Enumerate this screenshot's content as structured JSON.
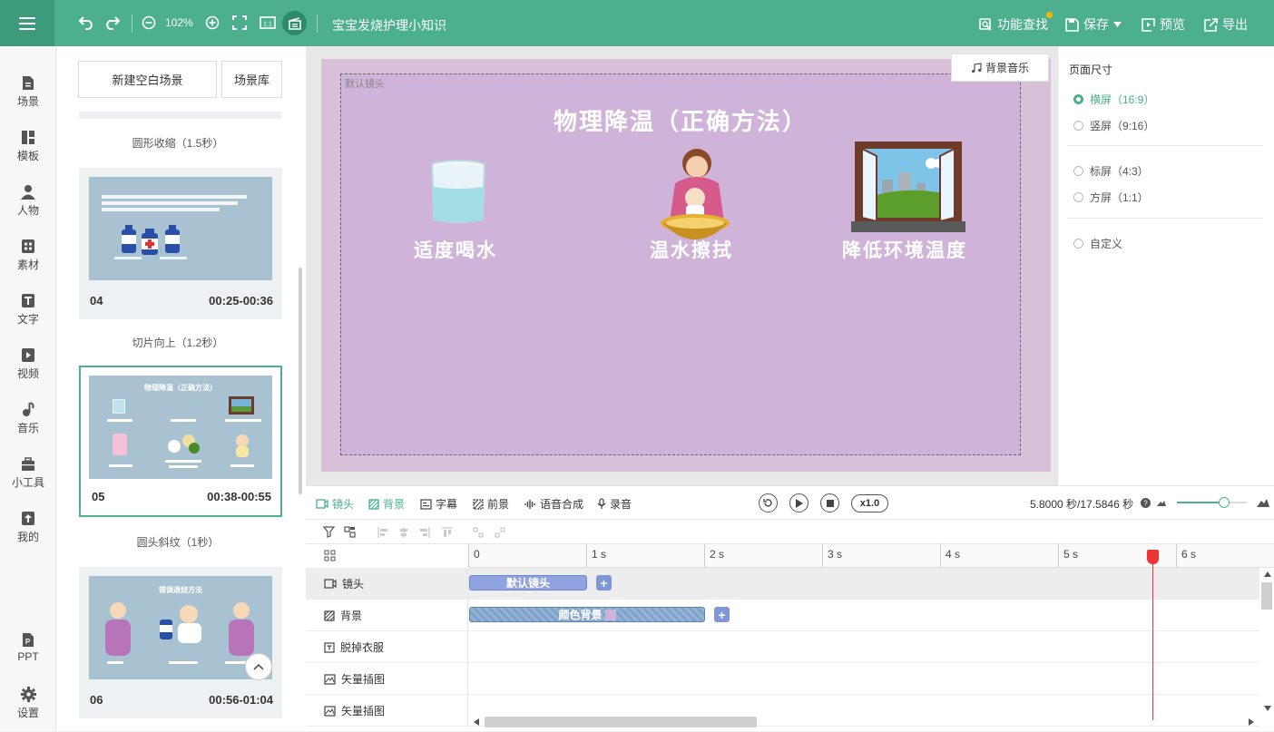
{
  "topbar": {
    "zoom": "102%",
    "doc_title": "宝宝发烧护理小知识",
    "feature_search": "功能查找",
    "save": "保存",
    "preview": "预览",
    "export": "导出",
    "accent": "#4caf8e"
  },
  "nav": [
    {
      "label": "场景",
      "icon": "scene-icon"
    },
    {
      "label": "模板",
      "icon": "template-icon"
    },
    {
      "label": "人物",
      "icon": "person-icon"
    },
    {
      "label": "素材",
      "icon": "material-icon"
    },
    {
      "label": "文字",
      "icon": "text-icon"
    },
    {
      "label": "视频",
      "icon": "video-icon"
    },
    {
      "label": "音乐",
      "icon": "music-icon"
    },
    {
      "label": "小工具",
      "icon": "toolbox-icon"
    },
    {
      "label": "我的",
      "icon": "mine-icon"
    },
    {
      "label": "PPT",
      "icon": "ppt-icon"
    },
    {
      "label": "设置",
      "icon": "settings-icon"
    }
  ],
  "scene_panel": {
    "new_scene": "新建空白场景",
    "library": "场景库",
    "transitions": [
      "圆形收缩（1.5秒）",
      "切片向上（1.2秒）",
      "圆头斜纹（1秒）"
    ],
    "scenes": [
      {
        "num": "04",
        "time": "00:25-00:36"
      },
      {
        "num": "05",
        "time": "00:38-00:55",
        "thumb_title": "物理降温（正确方法）"
      },
      {
        "num": "06",
        "time": "00:56-01:04",
        "thumb_title": "错误退烧方法"
      }
    ]
  },
  "stage": {
    "camera_label": "默认镜头",
    "music_button": "背景音乐",
    "title": "物理降温（正确方法）",
    "items": [
      "适度喝水",
      "温水擦拭",
      "降低环境温度"
    ]
  },
  "props": {
    "title": "页面尺寸",
    "options": [
      "横屏（16:9）",
      "竖屏（9:16）",
      "标屏（4:3）",
      "方屏（1:1）",
      "自定义"
    ],
    "selected": "横屏（16:9）"
  },
  "timeline": {
    "tabs": [
      "镜头",
      "背景",
      "字幕",
      "前景",
      "语音合成",
      "录音"
    ],
    "speed": "x1.0",
    "time_readout": "5.8000 秒/17.5846 秒",
    "ruler": [
      "0",
      "1 s",
      "2 s",
      "3 s",
      "4 s",
      "5 s",
      "6 s"
    ],
    "tracks": [
      {
        "label": "镜头",
        "icon": "camera-icon",
        "clip": "默认镜头"
      },
      {
        "label": "背景",
        "icon": "background-icon",
        "clip": "颜色背景"
      },
      {
        "label": "脱掉衣服",
        "icon": "text-icon",
        "clip": ""
      },
      {
        "label": "矢量插图",
        "icon": "image-icon",
        "clip": ""
      },
      {
        "label": "矢量插图",
        "icon": "image-icon",
        "clip": ""
      }
    ],
    "playhead_seconds": 5.8
  }
}
